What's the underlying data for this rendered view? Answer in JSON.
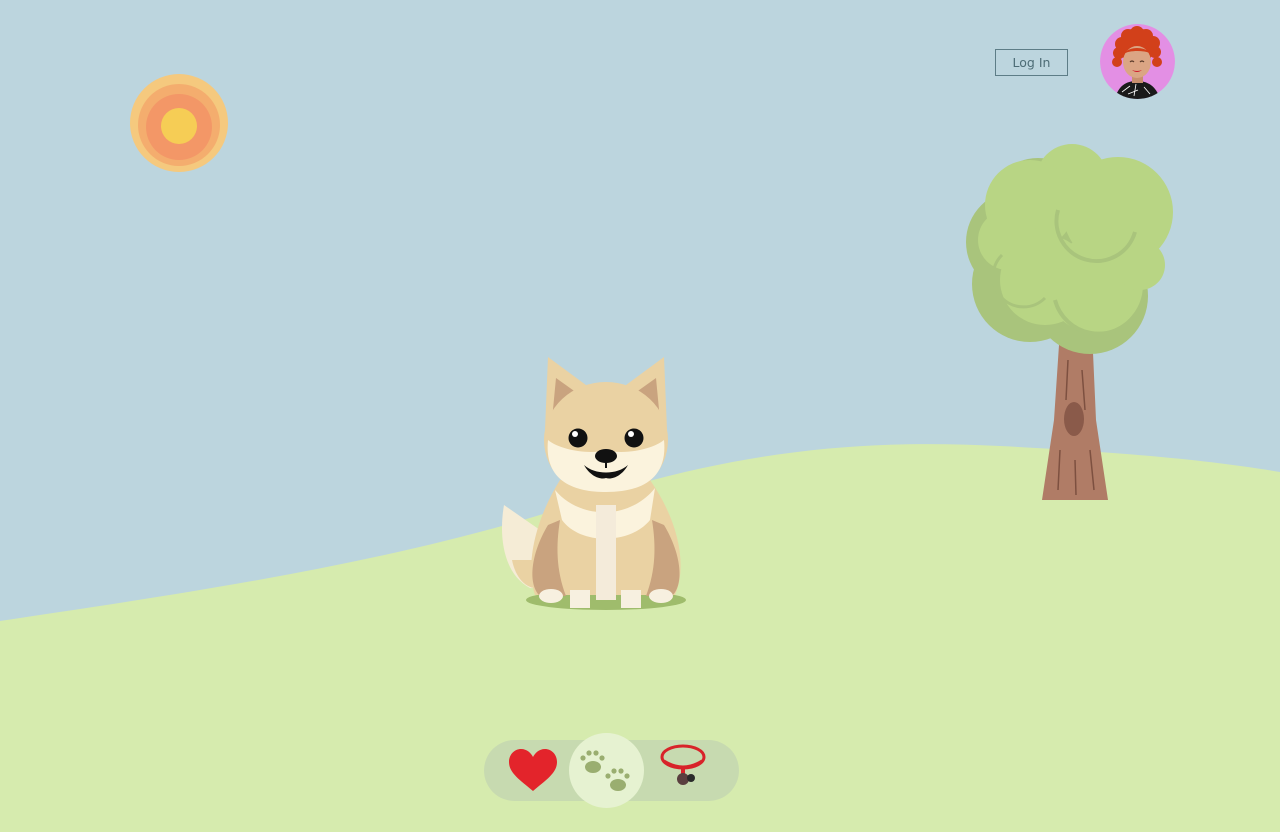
{
  "header": {
    "login_label": "Log In"
  },
  "user": {
    "avatar_icon": "curly-red-hair-woman-avatar-icon"
  },
  "toolbar": {
    "items": [
      {
        "icon": "heart-icon",
        "selected": false
      },
      {
        "icon": "paw-prints-icon",
        "selected": true
      },
      {
        "icon": "collar-icon",
        "selected": false
      }
    ]
  },
  "colors": {
    "sky": "#bcd5de",
    "grass": "#d6ebae",
    "heart": "#e3242b",
    "collar": "#d8232a",
    "selected_tool_bg": "#e6f2d1"
  }
}
